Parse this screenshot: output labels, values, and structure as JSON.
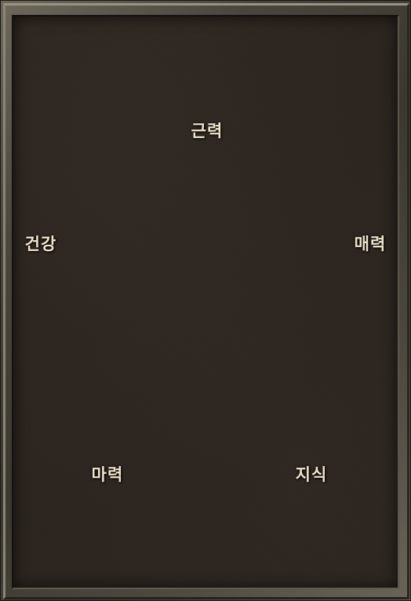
{
  "stats": {
    "strength": "근력",
    "health": "건강",
    "charm": "매력",
    "magic": "마력",
    "knowledge": "지식"
  }
}
